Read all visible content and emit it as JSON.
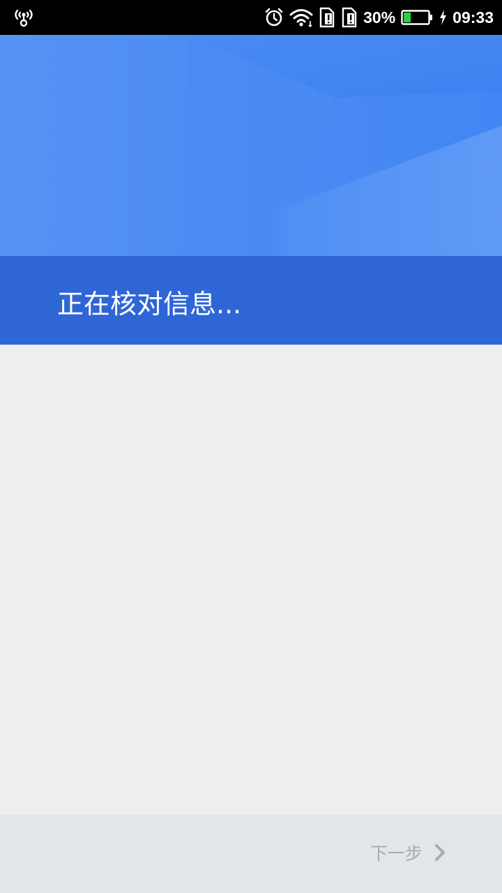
{
  "status_bar": {
    "battery_percent": "30%",
    "battery_level": 0.3,
    "time": "09:33",
    "icons": [
      "hotspot-icon",
      "alarm-icon",
      "wifi-icon",
      "sim-alert-icon",
      "sim-alert-icon",
      "battery-icon",
      "charging-icon"
    ]
  },
  "hero": {
    "title": "正在核对信息..."
  },
  "footer": {
    "next_label": "下一步"
  },
  "colors": {
    "hero_blue": "#4a8bf2",
    "band_blue": "#2f66d6",
    "background": "#eeeeee",
    "footer_bg": "#e3e6e8",
    "disabled_text": "#a7abae",
    "battery_green": "#2ecc40"
  }
}
